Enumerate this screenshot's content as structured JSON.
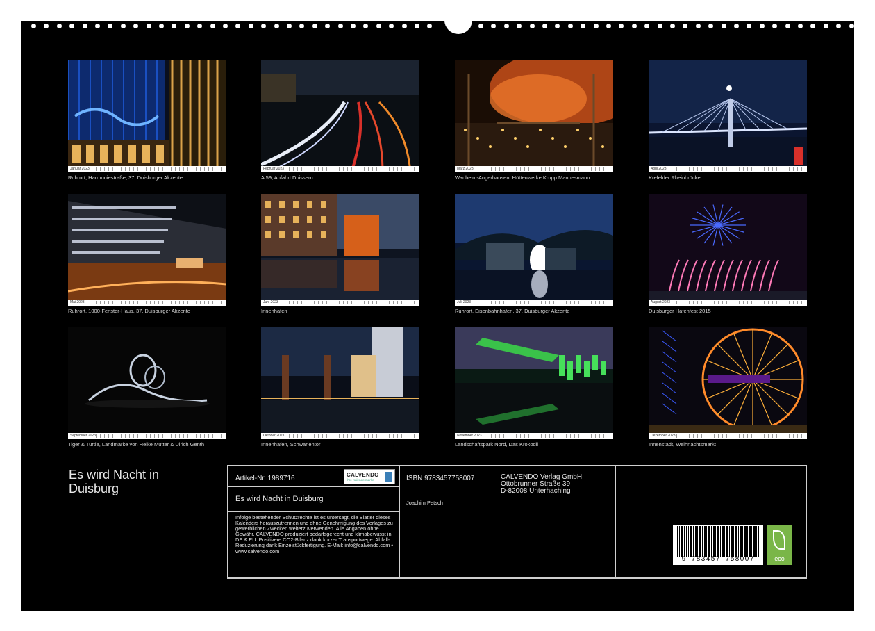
{
  "title_lines": [
    "Es wird Nacht in",
    "Duisburg"
  ],
  "photos": [
    {
      "month": "Januar 2023",
      "caption": "Ruhrort, Harmoniestraße, 37. Duisburger Akzente",
      "scene": "blue-glass-facade"
    },
    {
      "month": "Februar 2023",
      "caption": "A 59, Abfahrt Duissern",
      "scene": "highway-light-trails"
    },
    {
      "month": "März 2023",
      "caption": "Wanheim-Angerhausen, Hüttenwerke Krupp Mannesmann",
      "scene": "steelworks-orange-smoke"
    },
    {
      "month": "April 2023",
      "caption": "Krefelder Rheinbrücke",
      "scene": "bridge-moon"
    },
    {
      "month": "Mai 2023",
      "caption": "Ruhrort, 1000-Fenster-Haus, 37. Duisburger Akzente",
      "scene": "lettered-building"
    },
    {
      "month": "Juni 2023",
      "caption": "Innenhafen",
      "scene": "harbor-reflection"
    },
    {
      "month": "Juli 2023",
      "caption": "Ruhrort, Eisenbahnhafen, 37. Duisburger Akzente",
      "scene": "glowing-arch"
    },
    {
      "month": "August 2023",
      "caption": "Duisburger Hafenfest 2015",
      "scene": "fireworks"
    },
    {
      "month": "September 2023",
      "caption": "Tiger & Turtle, Landmarke von Heike Mutter & Ulrich Genth",
      "scene": "rollercoaster-sculpture"
    },
    {
      "month": "Oktober 2023",
      "caption": "Innenhafen, Schwanentor",
      "scene": "bridge-towers"
    },
    {
      "month": "November 2023",
      "caption": "Landschaftspark Nord, Das Krokodil",
      "scene": "green-crane"
    },
    {
      "month": "Dezember 2023",
      "caption": "Innenstadt, Weihnachtsmarkt",
      "scene": "ferris-wheel"
    }
  ],
  "info": {
    "article": "Artikel-Nr. 1989716",
    "logo_name": "CALVENDO",
    "logo_sub": "Ihre Kalendermarke",
    "title": "Es wird Nacht in Duisburg",
    "legal": "Infolge bestehender Schutzrechte ist es untersagt, die Blätter dieses Kalenders herauszutrennen und ohne Genehmigung des Verlages zu gewerblichen Zwecken weiterzuverwenden. Alle Angaben ohne Gewähr. CALVENDO produziert bedarfsgerecht und klimabewusst in DE & EU. Positivere CO2-Bilanz dank kurzer Transportwege. Abfall-Reduzierung dank Einzelstückfertigung. E-Mail: info@calvendo.com • www.calvendo.com",
    "isbn": "ISBN 9783457758007",
    "author": "Joachim Petsch",
    "publisher": [
      "CALVENDO Verlag GmbH",
      "Ottobrunner Straße 39",
      "D-82008 Unterhaching"
    ],
    "barcode_digits": "9 783457 758007",
    "eco_label": "eco"
  },
  "colors": {
    "background": "#000000",
    "border": "#cfcfcf",
    "eco_green": "#7ab648"
  }
}
